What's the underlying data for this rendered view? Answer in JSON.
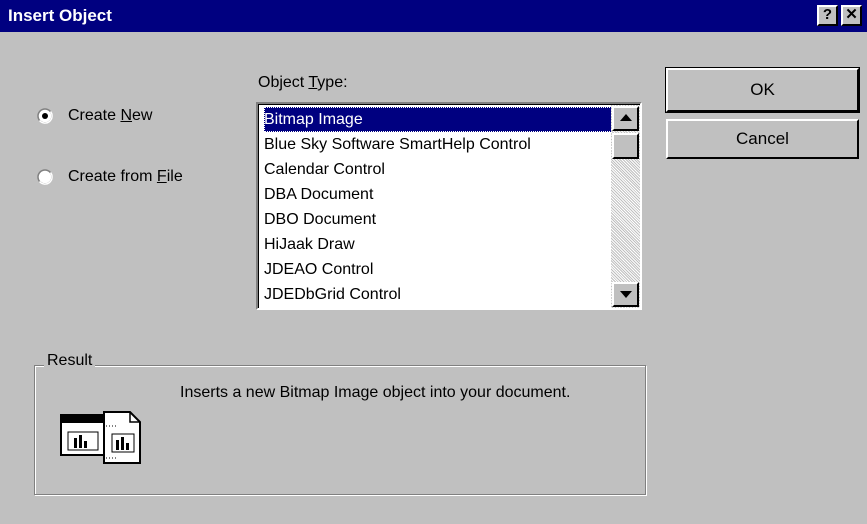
{
  "window": {
    "title": "Insert Object",
    "help_button": "?",
    "close_button": "✕"
  },
  "options": {
    "create_new_prefix": "Create ",
    "create_new_underlined": "N",
    "create_new_suffix": "ew",
    "create_from_file_prefix": "Create from ",
    "create_from_file_underlined": "F",
    "create_from_file_suffix": "ile",
    "selected": "create_new"
  },
  "object_type": {
    "label_prefix": "Object ",
    "label_underlined": "T",
    "label_suffix": "ype:",
    "items": [
      "Bitmap Image",
      "Blue Sky Software SmartHelp Control",
      "Calendar Control",
      "DBA Document",
      "DBO Document",
      "HiJaak Draw",
      "JDEAO Control",
      "JDEDbGrid Control"
    ],
    "selected_index": 0
  },
  "buttons": {
    "ok": "OK",
    "cancel": "Cancel"
  },
  "result": {
    "label": "Result",
    "text": "Inserts a new Bitmap Image object into your document."
  },
  "colors": {
    "title_bar": "#000080",
    "dialog_face": "#c0c0c0",
    "selection": "#000080"
  }
}
